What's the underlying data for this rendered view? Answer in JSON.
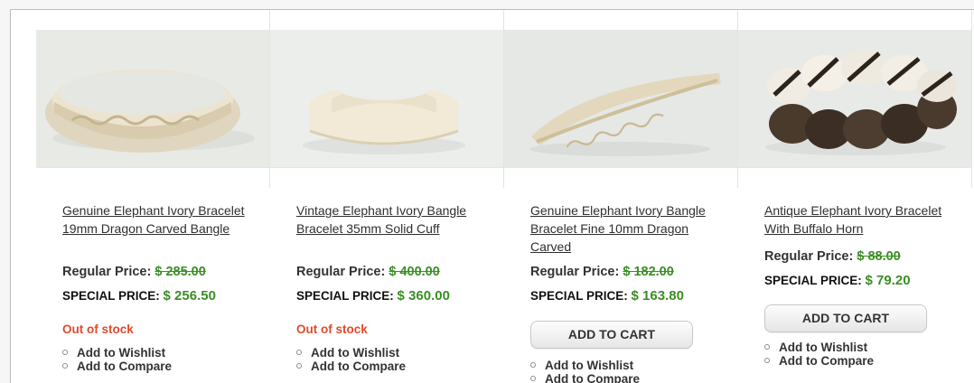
{
  "products": [
    {
      "name": "Genuine Elephant Ivory Bracelet 19mm Dragon Carved Bangle",
      "regular_label": "Regular Price:",
      "regular_price": "$ 285.00",
      "special_label": "SPECIAL PRICE:",
      "special_price": "$ 256.50",
      "stock": "Out of stock",
      "wishlist": "Add to Wishlist",
      "compare": "Add to Compare"
    },
    {
      "name": "Vintage Elephant Ivory Bangle Bracelet 35mm Solid Cuff",
      "regular_label": "Regular Price:",
      "regular_price": "$ 400.00",
      "special_label": "SPECIAL PRICE:",
      "special_price": "$ 360.00",
      "stock": "Out of stock",
      "wishlist": "Add to Wishlist",
      "compare": "Add to Compare"
    },
    {
      "name": "Genuine Elephant Ivory Bangle Bracelet Fine 10mm Dragon Carved",
      "regular_label": "Regular Price:",
      "regular_price": "$ 182.00",
      "special_label": "SPECIAL PRICE:",
      "special_price": "$ 163.80",
      "button": "ADD TO CART",
      "wishlist": "Add to Wishlist",
      "compare": "Add to Compare"
    },
    {
      "name": "Antique Elephant Ivory Bracelet With Buffalo Horn",
      "regular_label": "Regular Price:",
      "regular_price": "$ 88.00",
      "special_label": "SPECIAL PRICE:",
      "special_price": "$ 79.20",
      "button": "ADD TO CART",
      "wishlist": "Add to Wishlist",
      "compare": "Add to Compare"
    }
  ],
  "colors": {
    "price_green": "#3b8e25",
    "stock_red": "#e04b2c",
    "link_text": "#2f2f2f"
  }
}
